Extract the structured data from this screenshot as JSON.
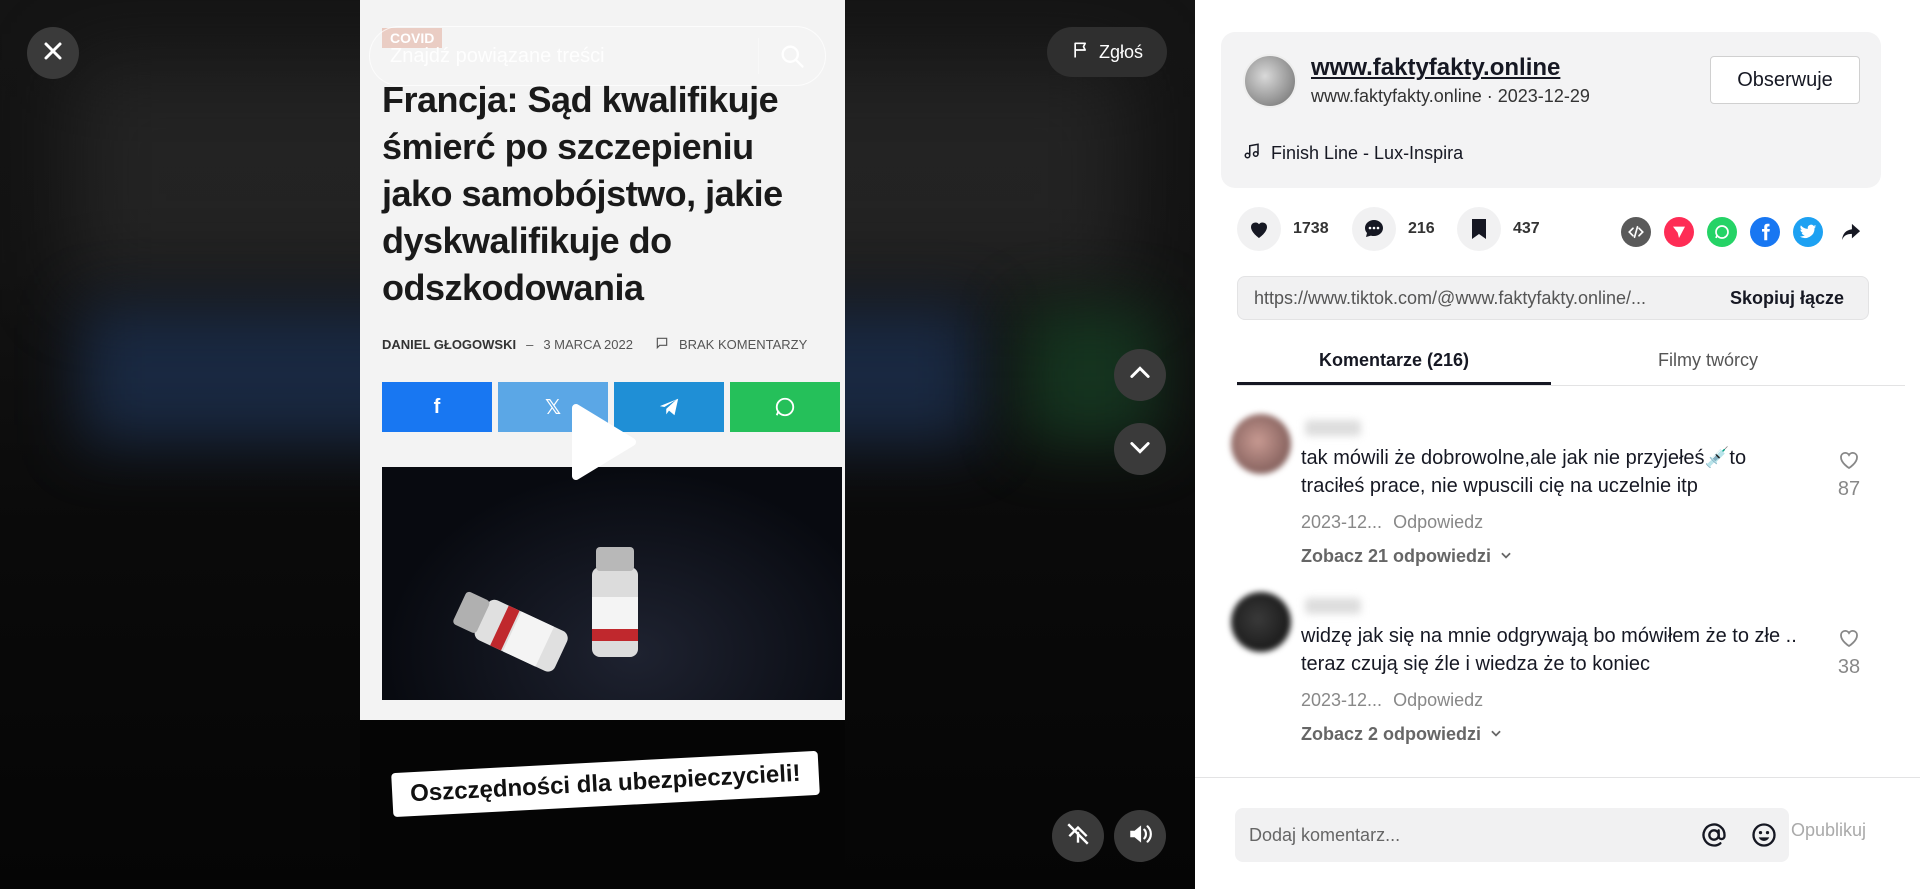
{
  "video": {
    "search_placeholder": "Znajdź powiązane treści",
    "report_label": "Zgłoś",
    "article": {
      "tag": "COVID",
      "title": "Francja: Sąd kwalifikuje śmierć po szczepieniu jako samobójstwo, jakie dyskwalifikuje do odszkodowania",
      "author": "DANIEL GŁOGOWSKI",
      "date": "3 MARCA 2022",
      "comments_label": "BRAK KOMENTARZY",
      "share_icons": [
        "facebook-icon",
        "x-icon",
        "telegram-icon",
        "whatsapp-icon"
      ],
      "share_colors": [
        "#1877f2",
        "#5ba7e6",
        "#1f8fd6",
        "#25c05a"
      ]
    },
    "caption": "Oszczędności dla ubezpieczycieli!"
  },
  "creator": {
    "name": "www.faktyfakty.online",
    "handle": "www.faktyfakty.online",
    "date": "2023-12-29",
    "follow_label": "Obserwuje",
    "music": "Finish Line - Lux-Inspira"
  },
  "stats": {
    "likes": "1738",
    "comments": "216",
    "saves": "437"
  },
  "share": {
    "url": "https://www.tiktok.com/@www.faktyfakty.online/...",
    "copy_label": "Skopiuj łącze"
  },
  "tabs": [
    {
      "label": "Komentarze (216)",
      "active": true
    },
    {
      "label": "Filmy twórcy",
      "active": false
    }
  ],
  "comments": [
    {
      "text": "tak mówili że dobrowolne,ale jak nie przyjełeś💉to traciłeś prace, nie wpuscili cię na uczelnie itp",
      "date": "2023-12...",
      "reply_label": "Odpowiedz",
      "likes": "87",
      "more_replies": "Zobacz 21 odpowiedzi"
    },
    {
      "text": "widzę jak się na mnie odgrywają bo mówiłem że to złe .. teraz czują się źle i wiedza że to koniec",
      "date": "2023-12...",
      "reply_label": "Odpowiedz",
      "likes": "38",
      "more_replies": "Zobacz 2 odpowiedzi"
    }
  ],
  "composer": {
    "placeholder": "Dodaj komentarz...",
    "post_label": "Opublikuj"
  }
}
